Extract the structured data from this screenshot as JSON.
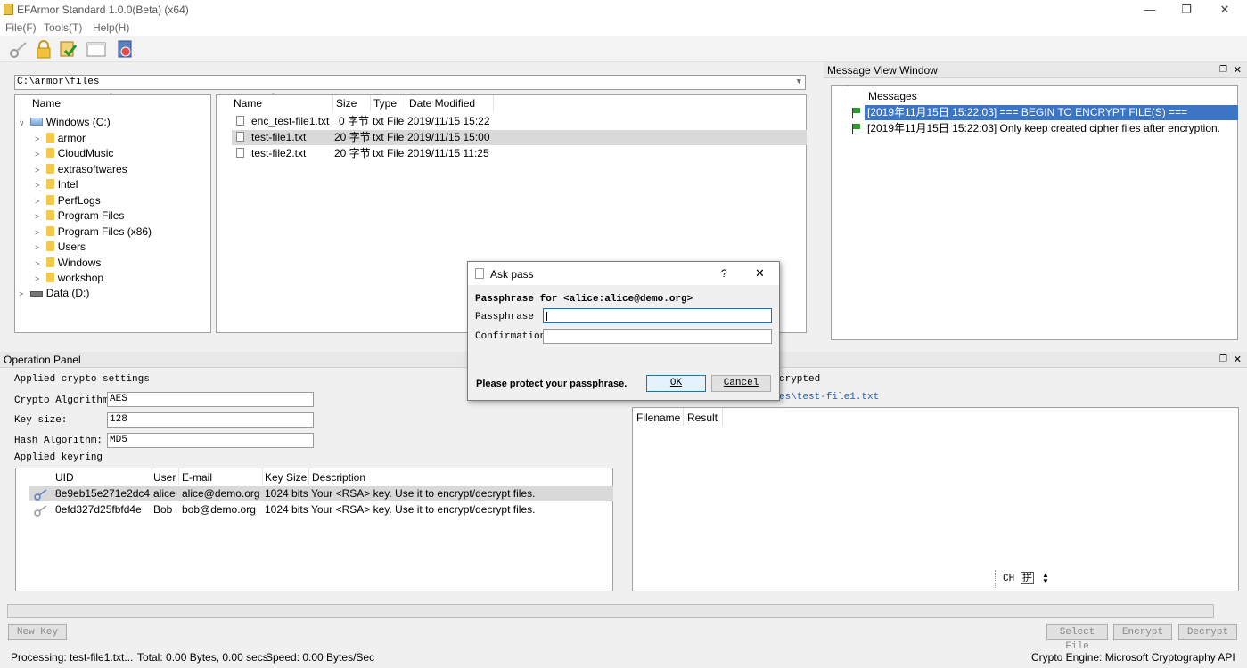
{
  "window": {
    "title": "EFArmor Standard 1.0.0(Beta) (x64)"
  },
  "menu": {
    "file": "File(F)",
    "tools": "Tools(T)",
    "help": "Help(H)"
  },
  "path_bar": {
    "value": "C:\\armor\\files"
  },
  "tree": {
    "header": "Name",
    "items": [
      {
        "label": "Windows (C:)"
      },
      {
        "label": "armor"
      },
      {
        "label": "CloudMusic"
      },
      {
        "label": "extrasoftwares"
      },
      {
        "label": "Intel"
      },
      {
        "label": "PerfLogs"
      },
      {
        "label": "Program Files"
      },
      {
        "label": "Program Files (x86)"
      },
      {
        "label": "Users"
      },
      {
        "label": "Windows"
      },
      {
        "label": "workshop"
      },
      {
        "label": "Data (D:)"
      }
    ]
  },
  "files": {
    "headers": {
      "name": "Name",
      "size": "Size",
      "type": "Type",
      "date": "Date Modified"
    },
    "rows": [
      {
        "name": "enc_test-file1.txt",
        "size": "0 字节",
        "type": "txt File",
        "date": "2019/11/15 15:22"
      },
      {
        "name": "test-file1.txt",
        "size": "20 字节",
        "type": "txt File",
        "date": "2019/11/15 15:00"
      },
      {
        "name": "test-file2.txt",
        "size": "20 字节",
        "type": "txt File",
        "date": "2019/11/15 11:25"
      }
    ]
  },
  "messages": {
    "panel_title": "Message View Window",
    "header": "Messages",
    "items": [
      "[2019年11月15日 15:22:03] === BEGIN TO ENCRYPT FILE(S) ===",
      "[2019年11月15日 15:22:03] Only keep created cipher files after encryption."
    ]
  },
  "operation": {
    "panel_title": "Operation Panel",
    "crypto_group": "Applied crypto settings",
    "algo_label": "Crypto Algorithm:",
    "algo_value": "AES",
    "keysize_label": "Key size:",
    "keysize_value": "128",
    "hash_label": "Hash Algorithm:",
    "hash_value": "MD5",
    "keyring_group": "Applied keyring",
    "keyring_headers": {
      "uid": "UID",
      "user": "User",
      "email": "E-mail",
      "keysize": "Key Size",
      "desc": "Description"
    },
    "keyring_rows": [
      {
        "uid": "8e9eb15e271e2dc4",
        "user": "alice",
        "email": "alice@demo.org",
        "keysize": "1024 bits",
        "desc": "Your <RSA> key. Use it to encrypt/decrypt files."
      },
      {
        "uid": "0efd327d25fbfd4e",
        "user": "Bob",
        "email": "bob@demo.org",
        "keysize": "1024 bits",
        "desc": "Your <RSA> key. Use it to encrypt/decrypt files."
      }
    ],
    "right_group_partial": "crypted",
    "right_path_partial": "es\\test-file1.txt",
    "results_headers": {
      "filename": "Filename",
      "result": "Result"
    },
    "ime_label": "CH",
    "ime_glyph": "拼"
  },
  "buttons": {
    "new_key": "New Key",
    "select_file": "Select File",
    "encrypt": "Encrypt",
    "decrypt": "Decrypt"
  },
  "status": {
    "processing": "Processing: test-file1.txt...",
    "total": "Total: 0.00 Bytes, 0.00 secs",
    "speed": "Speed: 0.00 Bytes/Sec",
    "engine": "Crypto Engine: Microsoft Cryptography API"
  },
  "dialog": {
    "title": "Ask pass",
    "help": "?",
    "close": "✕",
    "prompt": "Passphrase for <alice:alice@demo.org>",
    "pass_label": "Passphrase",
    "pass_value": "",
    "confirm_label": "Confirmation",
    "confirm_value": "",
    "note": "Please protect your passphrase.",
    "ok": "OK",
    "cancel": "Cancel"
  },
  "colors": {
    "selection": "#3b75c4",
    "row_highlight": "#d9d9d9",
    "flag": "#2a9d2a"
  }
}
